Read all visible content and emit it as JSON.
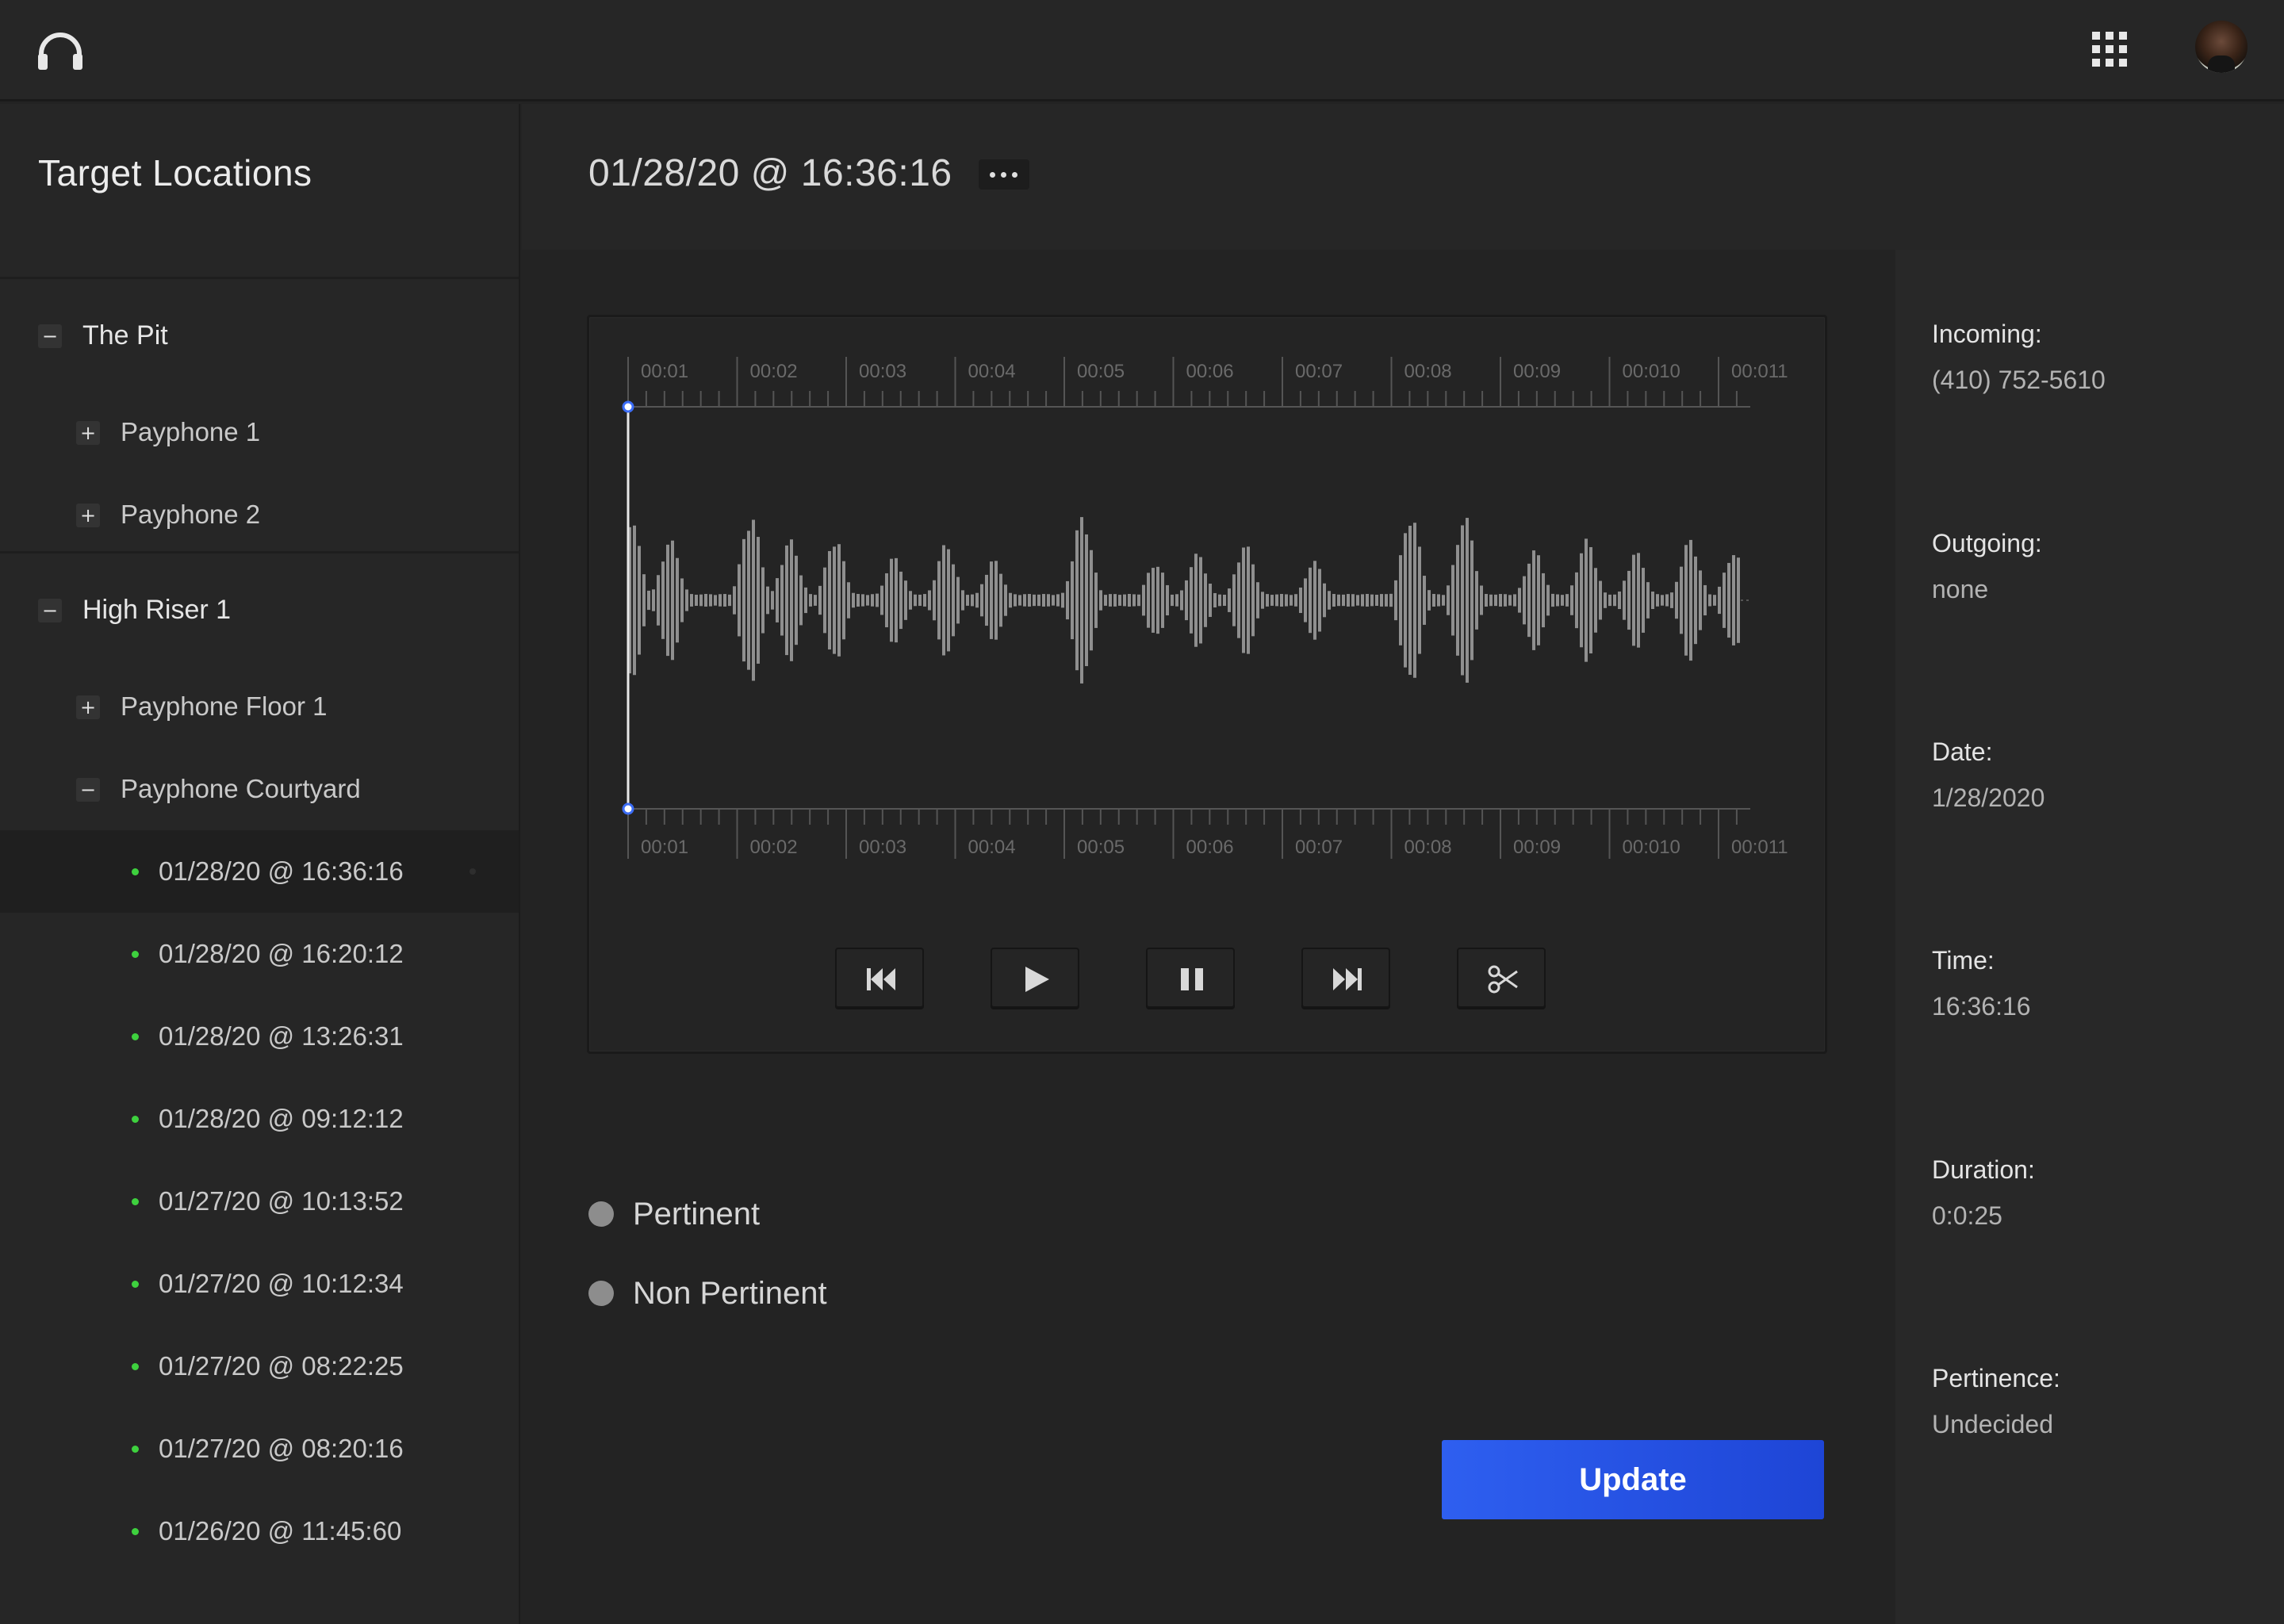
{
  "sidebar": {
    "title": "Target Locations",
    "tree": [
      {
        "label": "The Pit",
        "toggle": "−"
      },
      {
        "label": "Payphone 1",
        "toggle": "+"
      },
      {
        "label": "Payphone 2",
        "toggle": "+"
      },
      {
        "label": "High Riser 1",
        "toggle": "−"
      },
      {
        "label": "Payphone Floor 1",
        "toggle": "+"
      },
      {
        "label": "Payphone Courtyard",
        "toggle": "−"
      }
    ],
    "recordings": [
      "01/28/20 @ 16:36:16",
      "01/28/20 @ 16:20:12",
      "01/28/20 @ 13:26:31",
      "01/28/20 @ 09:12:12",
      "01/27/20 @ 10:13:52",
      "01/27/20 @ 10:12:34",
      "01/27/20 @ 08:22:25",
      "01/27/20 @ 08:20:16",
      "01/26/20 @ 11:45:60"
    ],
    "selected_index": 0,
    "status_color": "#3ed13e"
  },
  "header": {
    "title": "01/28/20 @ 16:36:16",
    "more_icon": "more-horizontal-icon"
  },
  "player": {
    "timeline_labels": [
      "00:01",
      "00:02",
      "00:03",
      "00:04",
      "00:05",
      "00:06",
      "00:07",
      "00:08",
      "00:09",
      "00:010",
      "00:011"
    ],
    "playhead_position": 0,
    "controls": [
      {
        "name": "skip-back",
        "icon": "skip-back-icon"
      },
      {
        "name": "play",
        "icon": "play-icon"
      },
      {
        "name": "pause",
        "icon": "pause-icon"
      },
      {
        "name": "skip-forward",
        "icon": "skip-forward-icon"
      },
      {
        "name": "clip",
        "icon": "scissors-icon"
      }
    ]
  },
  "pertinence_options": [
    "Pertinent",
    "Non Pertinent"
  ],
  "update_label": "Update",
  "details": [
    {
      "label": "Incoming:",
      "value": "(410) 752-5610"
    },
    {
      "label": "Outgoing:",
      "value": "none"
    },
    {
      "label": "Date:",
      "value": "1/28/2020"
    },
    {
      "label": "Time:",
      "value": "16:36:16"
    },
    {
      "label": "Duration:",
      "value": "0:0:25"
    },
    {
      "label": "Pertinence:",
      "value": "Undecided"
    }
  ],
  "colors": {
    "accent": "#2e5ff0",
    "playhead": "#3b6cf5",
    "background": "#232323"
  }
}
